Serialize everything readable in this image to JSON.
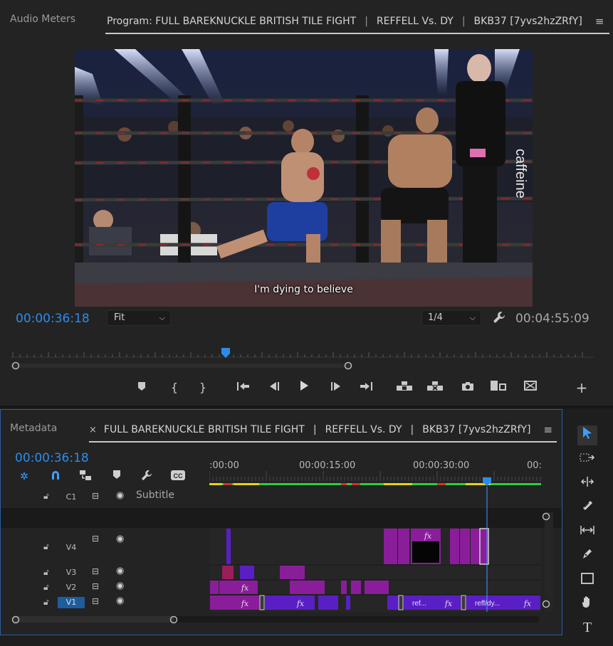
{
  "program_monitor": {
    "left_tab": "Audio Meters",
    "title_parts": [
      "Program: FULL BAREKNUCKLE BRITISH TILE FIGHT",
      "REFFELL Vs. DY",
      "BKB37 [7yvs2hzZRfY]"
    ],
    "caption": "I'm dying to believe",
    "current_timecode": "00:00:36:18",
    "duration_timecode": "00:04:55:09",
    "zoom": {
      "selected": "Fit"
    },
    "resolution": {
      "selected": "1/4"
    },
    "playhead_fraction": 0.37
  },
  "transport": {
    "buttons": [
      "add-marker",
      "mark-in",
      "mark-out",
      "go-to-in",
      "step-back",
      "play",
      "step-forward",
      "go-to-out",
      "lift",
      "extract",
      "export-frame",
      "insert",
      "overwrite",
      "add-button"
    ]
  },
  "timeline_panel": {
    "left_tab": "Metadata",
    "title_parts": [
      "FULL BAREKNUCKLE BRITISH TILE FIGHT",
      "REFFELL Vs. DY",
      "BKB37 [7yvs2hzZRfY]"
    ],
    "current_timecode": "00:00:36:18",
    "ruler_labels": [
      ":00:00",
      "00:00:15:00",
      "00:00:30:00",
      "00:"
    ],
    "tracks": [
      {
        "name": "C1",
        "label": "Subtitle"
      },
      {
        "name": "V4",
        "label": ""
      },
      {
        "name": "V3",
        "label": ""
      },
      {
        "name": "V2",
        "label": ""
      },
      {
        "name": "V1",
        "label": ""
      }
    ],
    "clip_labels": {
      "fx": "fx",
      "reff_short": "ref...",
      "reff_dy": "reff/dy..."
    }
  },
  "colors": {
    "accent_blue": "#2d8ceb",
    "clip_purple": "#7b1e9a",
    "clip_violet": "#5a1fc4",
    "clip_magenta": "#9b1e7a"
  }
}
